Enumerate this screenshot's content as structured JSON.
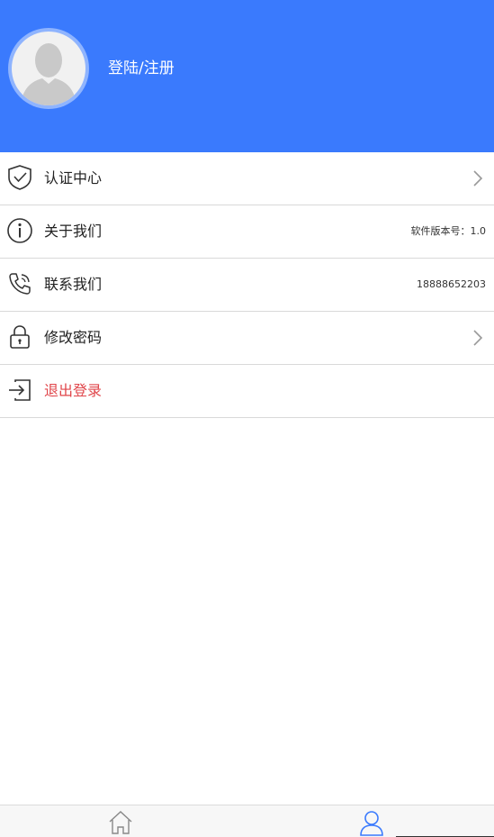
{
  "header": {
    "login_text": "登陆/注册",
    "avatar": "default-user-avatar"
  },
  "menu": [
    {
      "label": "认证中心",
      "icon": "shield-check-icon",
      "chevron": true
    },
    {
      "label": "关于我们",
      "icon": "info-icon",
      "value": "软件版本号：1.0"
    },
    {
      "label": "联系我们",
      "icon": "phone-icon",
      "value": "18888652203"
    },
    {
      "label": "修改密码",
      "icon": "lock-icon",
      "chevron": true
    },
    {
      "label": "退出登录",
      "icon": "logout-icon"
    }
  ],
  "tabbar": {
    "tabs": [
      {
        "icon": "home-icon",
        "active": false
      },
      {
        "icon": "user-icon",
        "active": true
      }
    ]
  },
  "colors": {
    "header_bg": "#3a7afd",
    "logout_text": "#e0454a",
    "active_tab": "#3a7afd"
  }
}
